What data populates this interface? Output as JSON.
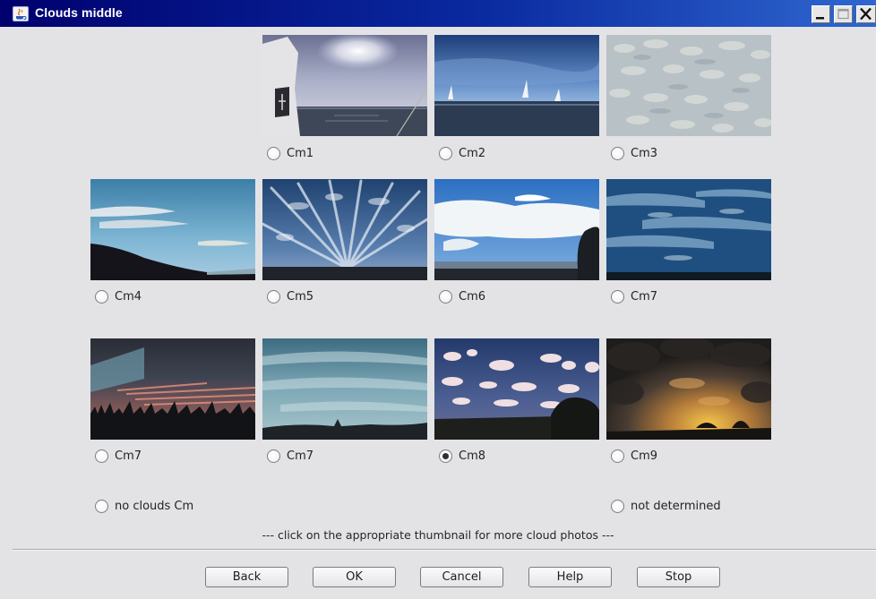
{
  "window": {
    "title": "Clouds middle",
    "controls": {
      "minimize": "minimize",
      "maximize": "maximize",
      "close": "close"
    }
  },
  "grid": [
    {
      "label": "Cm1",
      "checked": false
    },
    {
      "label": "Cm2",
      "checked": false
    },
    {
      "label": "Cm3",
      "checked": false
    },
    {
      "label": "Cm4",
      "checked": false
    },
    {
      "label": "Cm5",
      "checked": false
    },
    {
      "label": "Cm6",
      "checked": false
    },
    {
      "label": "Cm7",
      "checked": false
    },
    {
      "label": "Cm7",
      "checked": false
    },
    {
      "label": "Cm7",
      "checked": false
    },
    {
      "label": "Cm8",
      "checked": true
    },
    {
      "label": "Cm9",
      "checked": false
    }
  ],
  "extra_options": {
    "no_clouds": {
      "label": "no clouds Cm",
      "checked": false
    },
    "not_determined": {
      "label": "not determined",
      "checked": false
    }
  },
  "hint": "--- click on the appropriate thumbnail for more cloud photos ---",
  "buttons": {
    "back": "Back",
    "ok": "OK",
    "cancel": "Cancel",
    "help": "Help",
    "stop": "Stop"
  },
  "icons": {
    "app": "java-coffee-cup-icon",
    "minimize": "minimize-icon",
    "maximize": "maximize-icon",
    "close": "close-icon",
    "radio": "radio-button-icon"
  }
}
